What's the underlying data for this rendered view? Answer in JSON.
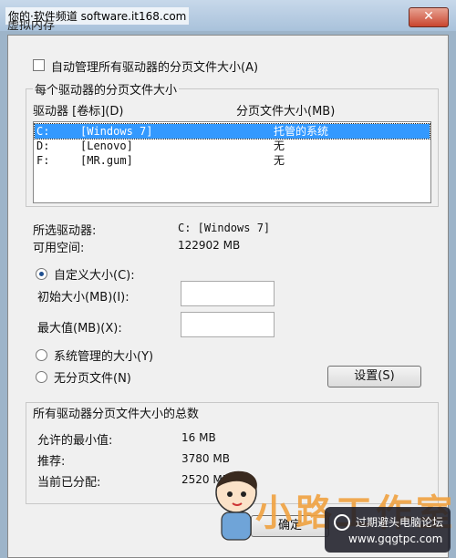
{
  "window": {
    "title": "虚拟内存",
    "close_glyph": "✕",
    "watermark": "你的·软件频道 software.it168.com"
  },
  "auto_manage": {
    "label": "自动管理所有驱动器的分页文件大小(A)",
    "checked": false
  },
  "per_drive": {
    "group_label": "每个驱动器的分页文件大小",
    "col_drive": "驱动器 [卷标](D)",
    "col_size": "分页文件大小(MB)",
    "rows": [
      {
        "drive": "C:",
        "label": "[Windows 7]",
        "size": "托管的系统",
        "selected": true
      },
      {
        "drive": "D:",
        "label": "[Lenovo]",
        "size": "无",
        "selected": false
      },
      {
        "drive": "F:",
        "label": "[MR.gum]",
        "size": "无",
        "selected": false
      }
    ]
  },
  "selected_drive": {
    "label": "所选驱动器:",
    "value": "C:  [Windows 7]",
    "space_label": "可用空间:",
    "space_value": "122902 MB"
  },
  "options": {
    "custom_label": "自定义大小(C):",
    "custom_selected": true,
    "initial_label": "初始大小(MB)(I):",
    "initial_value": "",
    "max_label": "最大值(MB)(X):",
    "max_value": "",
    "system_label": "系统管理的大小(Y)",
    "none_label": "无分页文件(N)",
    "set_button": "设置(S)"
  },
  "totals": {
    "group_label": "所有驱动器分页文件大小的总数",
    "min_label": "允许的最小值:",
    "min_value": "16 MB",
    "rec_label": "推荐:",
    "rec_value": "3780 MB",
    "cur_label": "当前已分配:",
    "cur_value": "2520 MB"
  },
  "footer": {
    "ok_button": "确定",
    "logo_text": "小路工作室",
    "site_text": "过期避头电脑论坛",
    "site_url": "www.gqgtpc.com"
  },
  "colors": {
    "selection": "#3399ff",
    "accent_logo": "#f0a240"
  }
}
